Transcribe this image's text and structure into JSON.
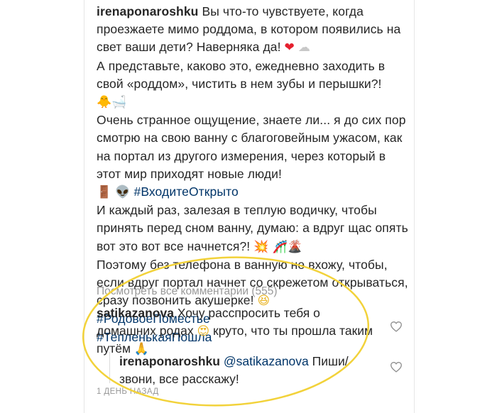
{
  "caption": {
    "author": "irenaponaroshku",
    "para1": " Вы что-то чувствуете, когда проезжаете мимо роддома, в котором появились на свет ваши дети? Наверняка да!",
    "para2": "А представьте, каково это, ежедневно заходить в свой «роддом», чистить в нем зубы и перышки?!",
    "para3": "Очень странное ощущение, знаете ли... я до сих пор смотрю на свою ванну с благоговейным ужасом, как на портал из другого измерения, через который в этот мир приходят новые люди!",
    "hashtag1": "#ВходитеОткрыто",
    "para4": "И каждый раз, залезая в теплую водичку, чтобы принять перед сном ванну, думаю: а вдруг щас опять вот это вот все начнется?!",
    "para5": "Поэтому без телефона в ванную не вхожу, чтобы, если вдруг портал начнет со скрежетом открываться, сразу позвонить акушерке!",
    "hashtag2": "#РодовоеПоместье",
    "hashtag3": "#ТепленькаяПошла"
  },
  "view_all_comments": "Посмотреть все комментарии (555)",
  "comment1": {
    "author": "satikazanova",
    "text_a": " Хочу расспросить тебя о домашних родах ",
    "text_b": " круто, что ты прошла таким путём "
  },
  "reply1": {
    "author": "irenaponaroshku",
    "mention": "@satikazanova",
    "text": " Пиши/звони, все расскажу!"
  },
  "timestamp": "1 ДЕНЬ НАЗАД",
  "icons": {
    "heart": "❤",
    "cloud": "☁",
    "chick": "🐥",
    "bath": "🛁",
    "door": "🚪",
    "alien": "👽",
    "boom": "💥",
    "slide": "🎢",
    "volcano": "🌋",
    "laugh": "😆",
    "love": "😍",
    "pray": "🙏"
  },
  "colors": {
    "hashtag": "#003569",
    "muted": "#999999",
    "highlight": "#f2d23a"
  }
}
